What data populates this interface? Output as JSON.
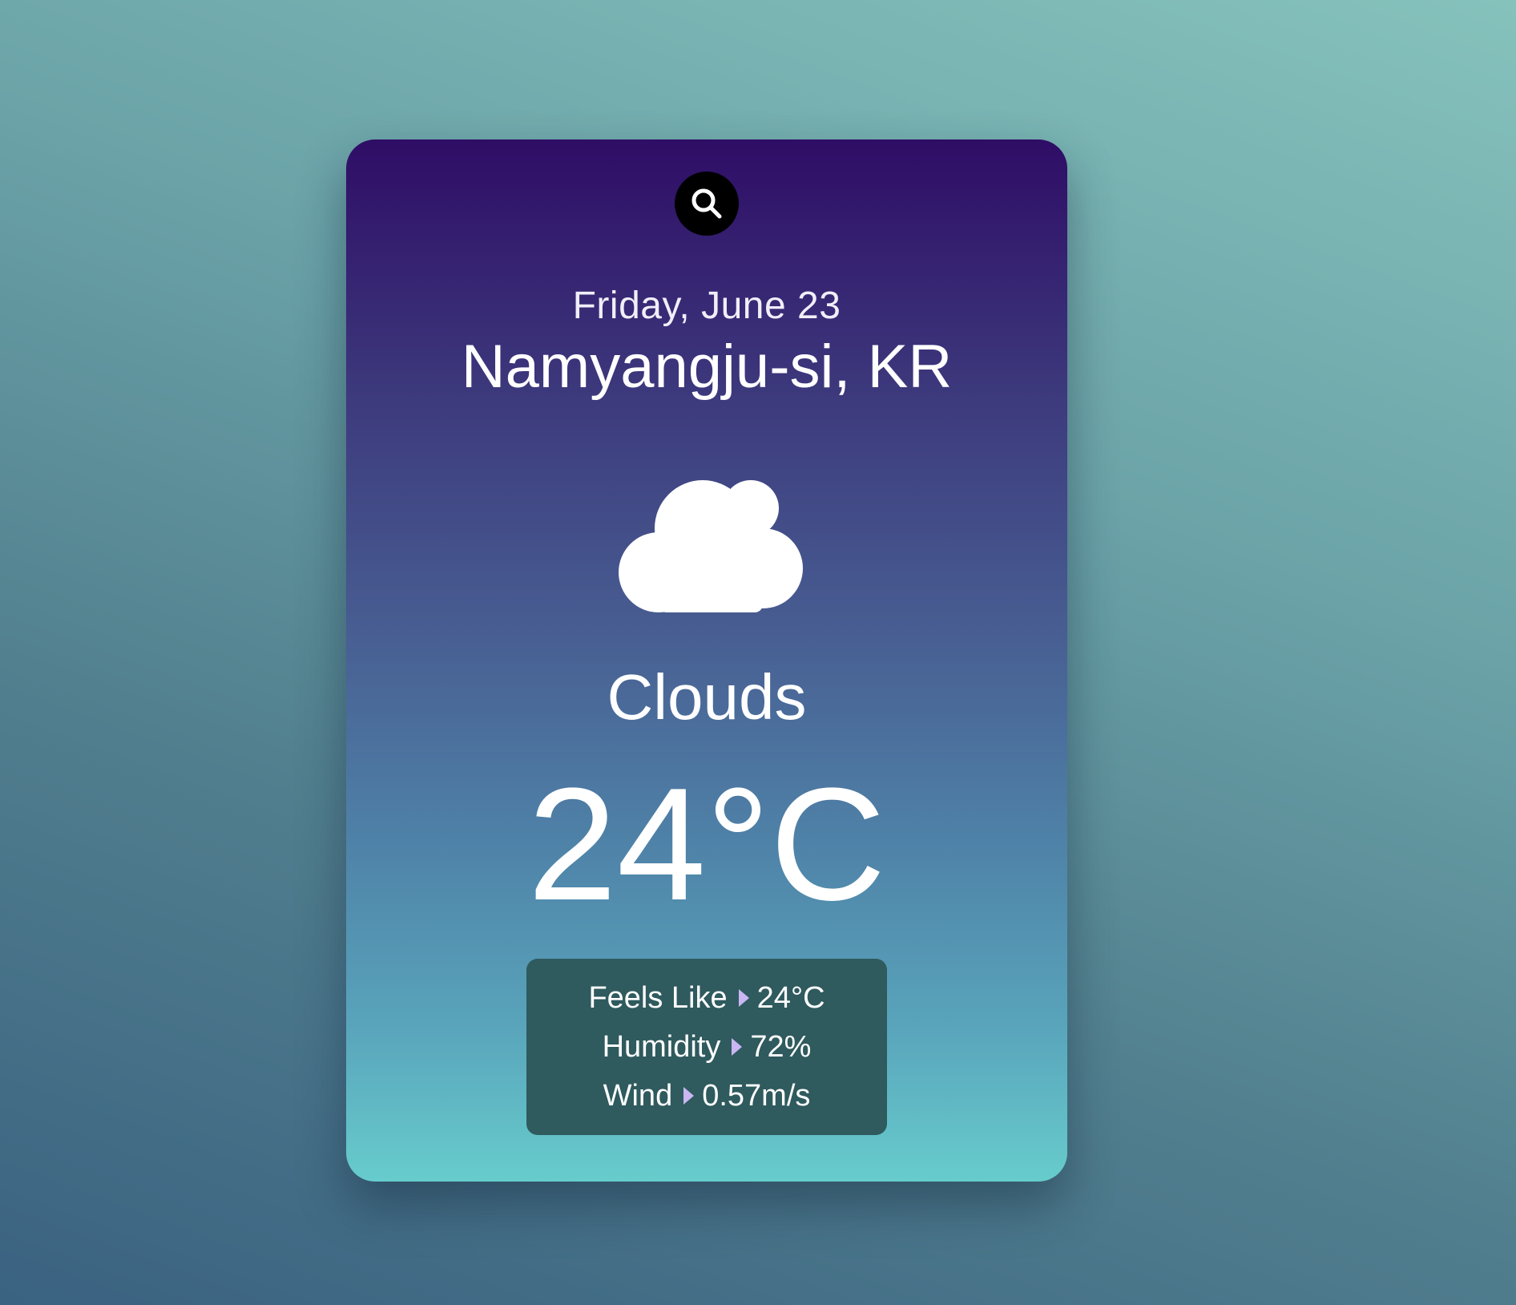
{
  "search": {
    "icon": "search-icon"
  },
  "weather": {
    "date": "Friday, June 23",
    "location": "Namyangju-si, KR",
    "icon": "cloud-icon",
    "condition": "Clouds",
    "temperature": "24°C"
  },
  "details": [
    {
      "label": "Feels Like",
      "value": "24°C"
    },
    {
      "label": "Humidity",
      "value": "72%"
    },
    {
      "label": "Wind",
      "value": "0.57m/s"
    }
  ],
  "colors": {
    "card_top": "#2f0d66",
    "card_bottom": "#67cccc",
    "details_bg": "#2f5a5e",
    "arrow": "#c9b6f2"
  }
}
